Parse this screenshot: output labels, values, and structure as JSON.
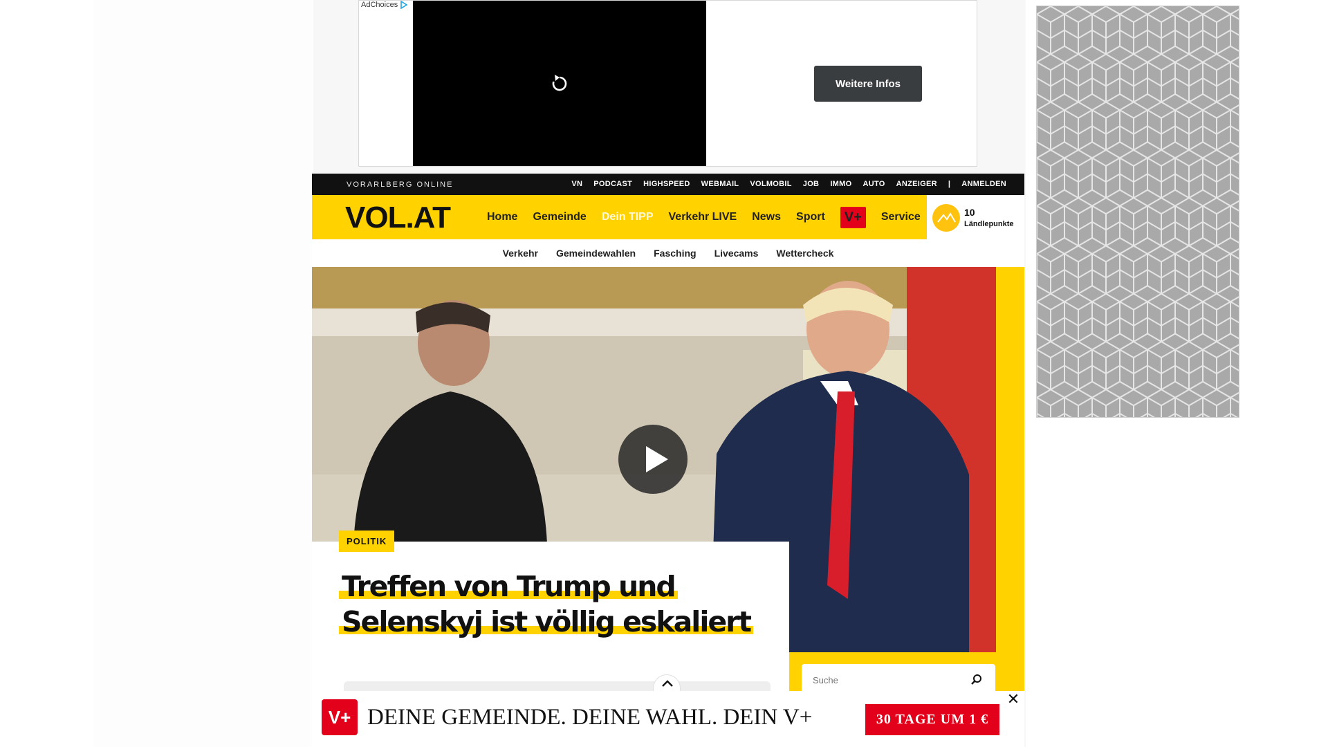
{
  "ad": {
    "adchoices_label": "AdChoices",
    "cta_label": "Weitere Infos",
    "replay_icon": "replay-icon"
  },
  "topbar": {
    "brand": "VORARLBERG ONLINE",
    "links": [
      "VN",
      "PODCAST",
      "HIGHSPEED",
      "WEBMAIL",
      "VOLMOBIL",
      "JOB",
      "IMMO",
      "AUTO",
      "ANZEIGER"
    ],
    "separator": "|",
    "login": "ANMELDEN"
  },
  "nav": {
    "logo": "VOL.AT",
    "items": [
      "Home",
      "Gemeinde",
      "Dein TIPP",
      "Verkehr LIVE",
      "News",
      "Sport"
    ],
    "vplus": "V+",
    "service": "Service",
    "points_value": "10",
    "points_label": "Ländlepunkte"
  },
  "subnav": {
    "items": [
      "Verkehr",
      "Gemeindewahlen",
      "Fasching",
      "Livecams",
      "Wettercheck"
    ]
  },
  "hero": {
    "category": "POLITIK",
    "headline_line1": "Treffen von Trump und",
    "headline_line2": "Selenskyj ist völlig eskaliert"
  },
  "search": {
    "placeholder": "Suche"
  },
  "banner": {
    "logo": "V+",
    "text": "DEINE GEMEINDE. DEINE WAHL. DEIN V+",
    "cta": "30 TAGE UM 1 €",
    "close": "✕"
  },
  "colors": {
    "brand_yellow": "#ffd200",
    "vplus_red": "#e2001a",
    "topbar_black": "#111111"
  }
}
